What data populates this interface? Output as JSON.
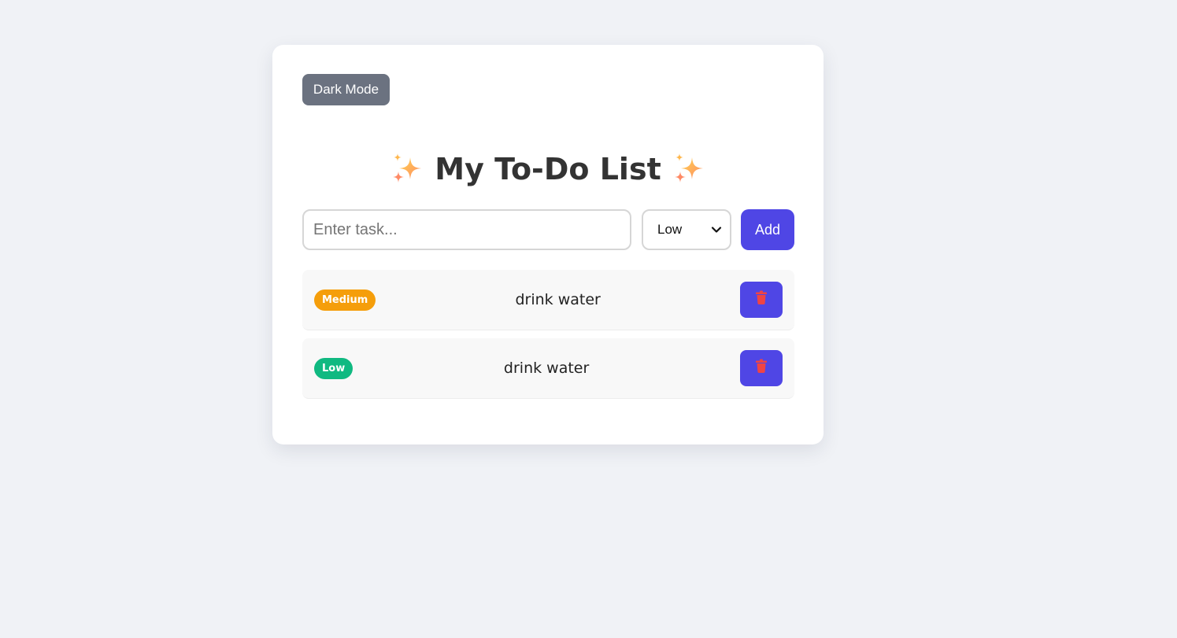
{
  "app": {
    "dark_mode_label": "Dark Mode",
    "title": "My To-Do List",
    "title_icon": "sparkles-icon"
  },
  "form": {
    "task_placeholder": "Enter task...",
    "task_value": "",
    "priority_selected": "Low",
    "add_label": "Add"
  },
  "tasks": [
    {
      "priority": "Medium",
      "priority_color": "#f59e0b",
      "text": "drink water"
    },
    {
      "priority": "Low",
      "priority_color": "#10b981",
      "text": "drink water"
    }
  ],
  "colors": {
    "accent": "#4f46e5",
    "delete_icon": "#ef4444",
    "dark_mode_button": "#6b7280",
    "background": "#f0f2f6"
  }
}
